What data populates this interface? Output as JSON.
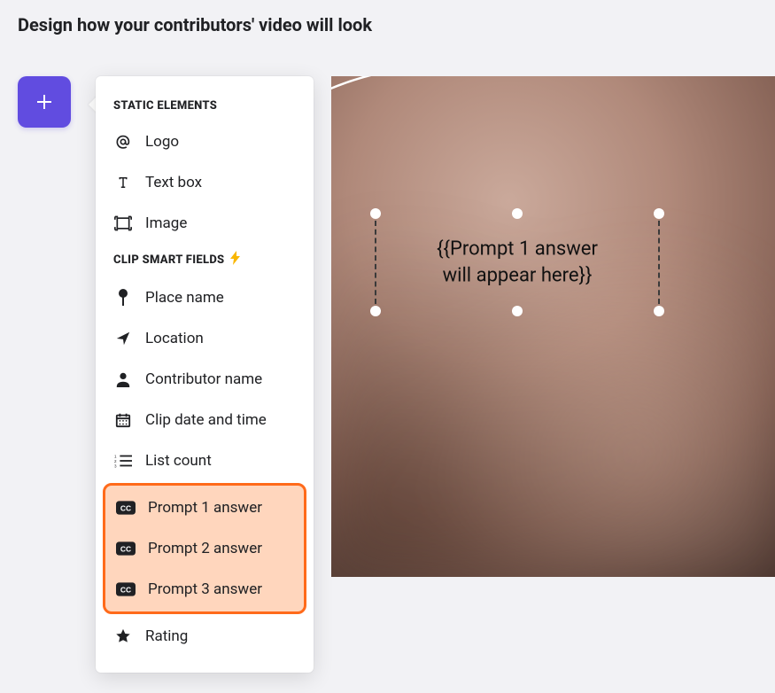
{
  "page": {
    "title": "Design how your contributors' video will look"
  },
  "add_button": {
    "label": "Add element"
  },
  "menu": {
    "section_static": "STATIC ELEMENTS",
    "section_smart": "CLIP SMART FIELDS",
    "items": {
      "logo": "Logo",
      "textbox": "Text box",
      "image": "Image",
      "place": "Place name",
      "location": "Location",
      "contributor": "Contributor name",
      "datetime": "Clip date and time",
      "listcount": "List count",
      "prompt1": "Prompt 1 answer",
      "prompt2": "Prompt 2 answer",
      "prompt3": "Prompt 3 answer",
      "rating": "Rating"
    }
  },
  "canvas": {
    "placeholder_line1": "{{Prompt 1 answer",
    "placeholder_line2": "will appear here}}"
  }
}
